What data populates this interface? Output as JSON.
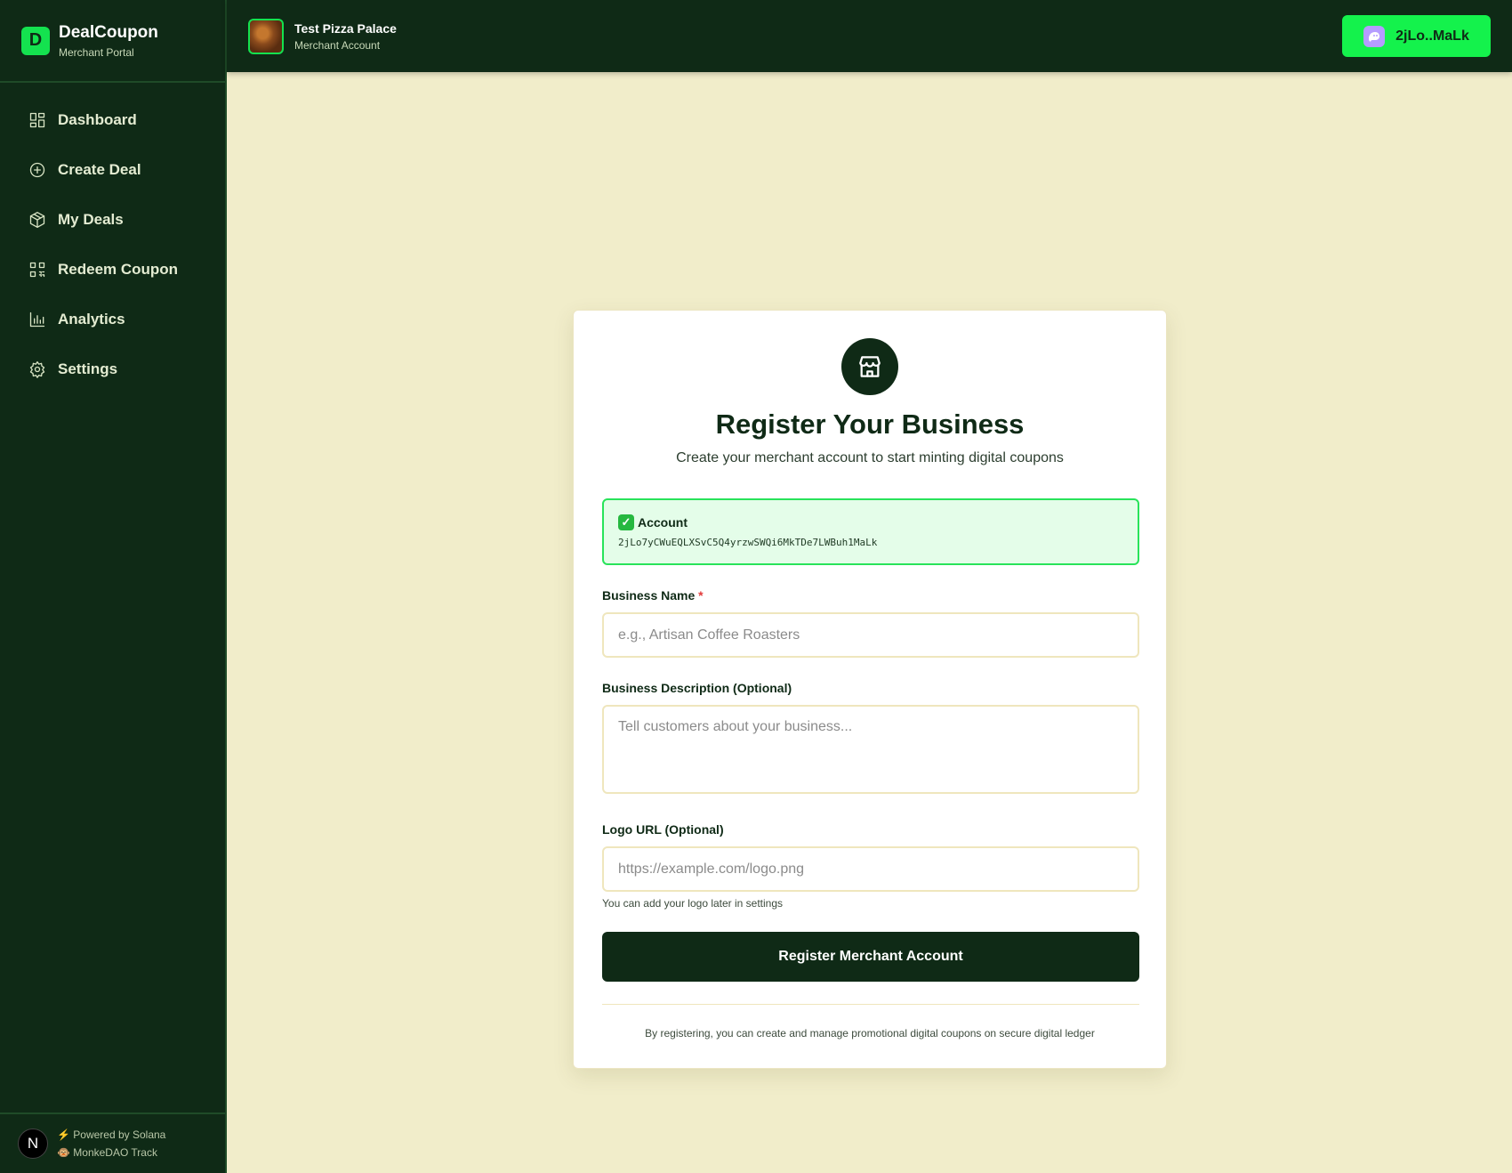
{
  "brand": {
    "letter": "D",
    "title": "DealCoupon",
    "subtitle": "Merchant Portal"
  },
  "nav": [
    {
      "label": "Dashboard",
      "icon": "dashboard-icon"
    },
    {
      "label": "Create Deal",
      "icon": "plus-circle-icon"
    },
    {
      "label": "My Deals",
      "icon": "box-icon"
    },
    {
      "label": "Redeem Coupon",
      "icon": "qr-code-icon"
    },
    {
      "label": "Analytics",
      "icon": "bar-chart-icon"
    },
    {
      "label": "Settings",
      "icon": "gear-icon"
    }
  ],
  "footer": {
    "avatar_letter": "N",
    "line1": "⚡ Powered by Solana",
    "line2": "🐵 MonkeDAO Track"
  },
  "topbar": {
    "store_name": "Test Pizza Palace",
    "store_sub": "Merchant Account",
    "wallet_label": "2jLo..MaLk"
  },
  "card": {
    "title": "Register Your Business",
    "subtitle": "Create your merchant account to start minting digital coupons",
    "account_label": "Account",
    "account_address": "2jLo7yCWuEQLXSvC5Q4yrzwSWQi6MkTDe7LWBuh1MaLk",
    "business_name_label": "Business Name",
    "business_name_required": "*",
    "business_name_placeholder": "e.g., Artisan Coffee Roasters",
    "description_label": "Business Description (Optional)",
    "description_placeholder": "Tell customers about your business...",
    "logo_label": "Logo URL (Optional)",
    "logo_placeholder": "https://example.com/logo.png",
    "logo_hint": "You can add your logo later in settings",
    "submit_label": "Register Merchant Account",
    "footnote": "By registering, you can create and manage promotional digital coupons on secure digital ledger"
  },
  "colors": {
    "accent": "#14f24c",
    "dark": "#0f2a16",
    "background": "#f1edca"
  }
}
